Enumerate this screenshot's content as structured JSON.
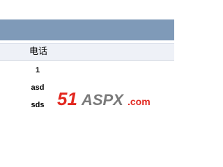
{
  "table": {
    "header": {
      "label": "电话"
    },
    "rows": [
      {
        "value": "1"
      },
      {
        "value": "asd"
      },
      {
        "value": "sds"
      }
    ]
  },
  "watermark": {
    "big": "51",
    "middle": "ASPX",
    "tail": ".com",
    "colors": {
      "red": "#e22820",
      "gray": "#7a7a7a"
    }
  }
}
